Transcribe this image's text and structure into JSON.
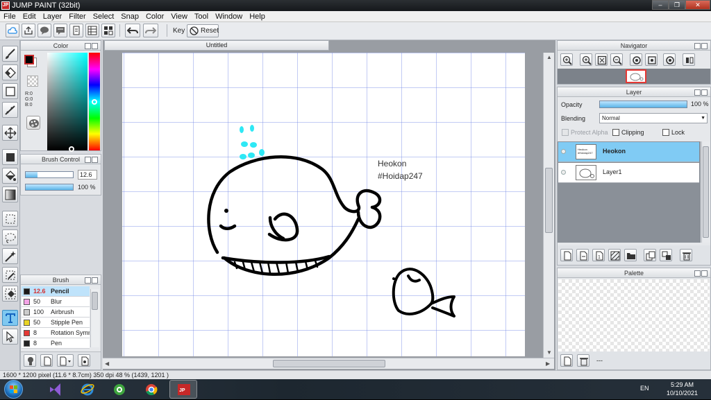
{
  "window": {
    "title": "JUMP PAINT (32bit)",
    "app_icon": "jump-paint-icon",
    "controls": [
      "minimize-icon",
      "restore-icon",
      "close-icon"
    ]
  },
  "menu": [
    "File",
    "Edit",
    "Layer",
    "Filter",
    "Select",
    "Snap",
    "Color",
    "View",
    "Tool",
    "Window",
    "Help"
  ],
  "toolbar": {
    "key_label": "Key",
    "reset_label": "Reset",
    "icons": [
      "cloud-icon",
      "share-icon",
      "comment-icon",
      "message-icon",
      "document-icon",
      "settings-grid-icon",
      "grid-icon",
      "undo-icon",
      "redo-icon"
    ]
  },
  "tools": [
    "brush-icon",
    "eraser-icon",
    "rectangle-select-icon",
    "line-icon",
    "move-icon",
    "fill-rect-icon",
    "bucket-icon",
    "gradient-icon",
    "marquee-icon",
    "lasso-icon",
    "magic-wand-icon",
    "eyedropper-icon",
    "eraser-select-icon",
    "text-tool-icon",
    "transform-icon"
  ],
  "color_panel": {
    "title": "Color",
    "foreground": "#000000",
    "background": "#ffffff",
    "r_label": "R:0",
    "g_label": "G:0",
    "b_label": "B:0",
    "hue_position": 0.5
  },
  "brush_control": {
    "title": "Brush Control",
    "size": "12.6",
    "opacity": "100 %"
  },
  "brush_panel": {
    "title": "Brush",
    "items": [
      {
        "size": "12.6",
        "name": "Pencil",
        "color": "#1a1a1a",
        "selected": true
      },
      {
        "size": "50",
        "name": "Blur",
        "color": "#f4a3e6",
        "selected": false
      },
      {
        "size": "100",
        "name": "Airbrush",
        "color": "#cccccc",
        "selected": false
      },
      {
        "size": "50",
        "name": "Stipple Pen",
        "color": "#e8d424",
        "selected": false
      },
      {
        "size": "8",
        "name": "Rotation Symm",
        "color": "#e53935",
        "selected": false
      },
      {
        "size": "8",
        "name": "Pen",
        "color": "#222222",
        "selected": false
      }
    ]
  },
  "document": {
    "tab": "Untitled",
    "text_line1": "Heokon",
    "text_line2": "#Hoidap247"
  },
  "navigator": {
    "title": "Navigator"
  },
  "layer_panel": {
    "title": "Layer",
    "opacity_label": "Opacity",
    "opacity_value": "100 %",
    "blending_label": "Blending",
    "blending_value": "Normal",
    "protect_alpha": "Protect Alpha",
    "clipping": "Clipping",
    "lock": "Lock",
    "layers": [
      {
        "name": "Heokon",
        "thumb_text": "Heokon #Hoidap247",
        "selected": true
      },
      {
        "name": "Layer1",
        "thumb_text": "",
        "selected": false
      }
    ]
  },
  "palette_panel": {
    "title": "Palette",
    "footer_text": "---"
  },
  "status": {
    "text": "1600 * 1200 pixel   (11.6 * 8.7cm)   350 dpi   48 %   (1439, 1201 )"
  },
  "taskbar": {
    "apps": [
      "visual-studio-icon",
      "internet-explorer-icon",
      "coccoc-browser-icon",
      "chrome-icon",
      "jump-paint-icon"
    ],
    "lang": "EN",
    "time": "5:29 AM",
    "date": "10/10/2021"
  }
}
